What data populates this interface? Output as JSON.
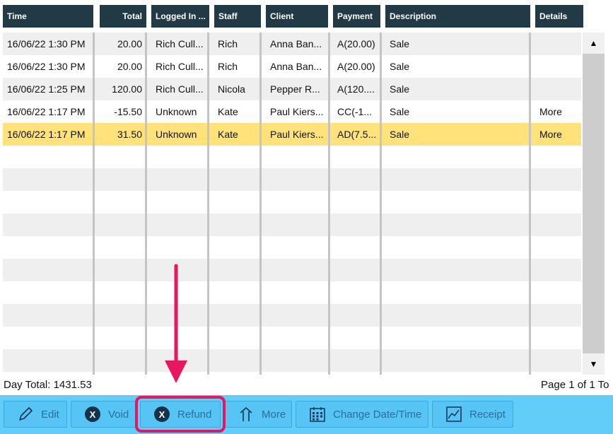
{
  "columns": [
    {
      "key": "time",
      "label": "Time"
    },
    {
      "key": "total",
      "label": "Total"
    },
    {
      "key": "logged_in",
      "label": "Logged In ..."
    },
    {
      "key": "staff",
      "label": "Staff"
    },
    {
      "key": "client",
      "label": "Client"
    },
    {
      "key": "payment",
      "label": "Payment"
    },
    {
      "key": "description",
      "label": "Description"
    },
    {
      "key": "details",
      "label": "Details"
    }
  ],
  "rows": [
    {
      "time": "16/06/22 1:30 PM",
      "total": "20.00",
      "logged_in": "Rich Cull...",
      "staff": "Rich",
      "client": "Anna Ban...",
      "payment": "A(20.00)",
      "description": "Sale",
      "details": ""
    },
    {
      "time": "16/06/22 1:30 PM",
      "total": "20.00",
      "logged_in": "Rich Cull...",
      "staff": "Rich",
      "client": "Anna Ban...",
      "payment": "A(20.00)",
      "description": "Sale",
      "details": ""
    },
    {
      "time": "16/06/22 1:25 PM",
      "total": "120.00",
      "logged_in": "Rich Cull...",
      "staff": "Nicola",
      "client": "Pepper R...",
      "payment": "A(120....",
      "description": "Sale",
      "details": ""
    },
    {
      "time": "16/06/22 1:17 PM",
      "total": "-15.50",
      "logged_in": "Unknown",
      "staff": "Kate",
      "client": "Paul Kiers...",
      "payment": "CC(-1...",
      "description": "Sale",
      "details": "More"
    },
    {
      "time": "16/06/22 1:17 PM",
      "total": "31.50",
      "logged_in": "Unknown",
      "staff": "Kate",
      "client": "Paul Kiers...",
      "payment": "AD(7.5...",
      "description": "Sale",
      "details": "More"
    }
  ],
  "selected_row_index": 4,
  "footer": {
    "day_total": "Day Total: 1431.53",
    "page_info": "Page 1 of 1  To"
  },
  "toolbar": {
    "edit": "Edit",
    "void": "Void",
    "refund": "Refund",
    "more": "More",
    "change_datetime": "Change Date/Time",
    "receipt": "Receipt"
  },
  "icons": {
    "scroll_up": "▲",
    "scroll_down": "▼",
    "void_icon": "X",
    "refund_icon": "X"
  },
  "colors": {
    "header_bg": "#213a45",
    "selected_row": "#ffe27a",
    "toolbar_bg": "#62cdf9",
    "highlight": "#e8155f"
  }
}
